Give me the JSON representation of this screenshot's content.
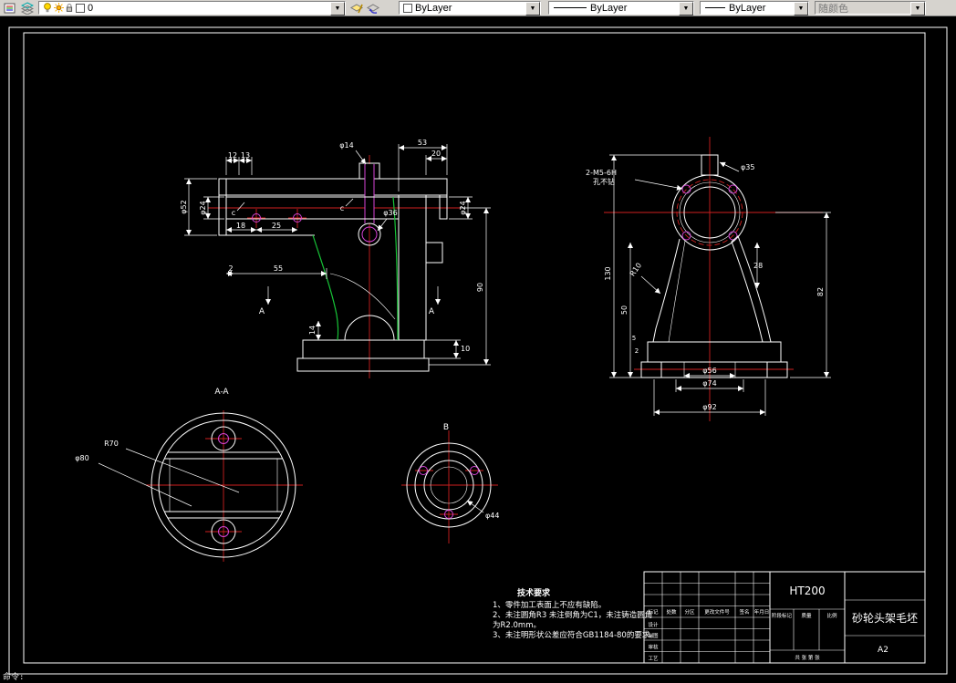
{
  "toolbar": {
    "layer_value": "0",
    "color_value": "ByLayer",
    "linetype_value": "ByLayer",
    "lineweight_value": "ByLayer",
    "plotstyle_value": "随颜色"
  },
  "statusbar": {
    "command": "命令:"
  },
  "colors": {
    "outline": "#ffffff",
    "centerline": "#cf1f1f",
    "contour_green": "#17c437",
    "hole_magenta": "#d643d6",
    "hatch_red": "#cf3060",
    "hatch_purple": "#9a35a8"
  },
  "views": {
    "front": {
      "dims": [
        "12",
        "13",
        "53",
        "20",
        "φ14",
        "φ52",
        "φ24",
        "18",
        "25",
        "2",
        "55",
        "90",
        "10",
        "14",
        "φ36",
        "φ24",
        "c",
        "c",
        "A",
        "A"
      ]
    },
    "side": {
      "dims": [
        "130",
        "50",
        "82",
        "28",
        "φ56",
        "φ74",
        "φ92",
        "R10",
        "φ35",
        "2-M5-6H",
        "孔不钻",
        "5",
        "2"
      ]
    },
    "section_a": {
      "labels": [
        "A-A",
        "R70",
        "φ80"
      ]
    },
    "view_b": {
      "labels": [
        "B",
        "φ44"
      ]
    }
  },
  "tech_req": {
    "title": "技术要求",
    "lines": [
      "1、零件加工表面上不应有缺陷。",
      "2、未注圆角R3 未注倒角为C1，未注铸造圆角",
      "为R2.0mm。",
      "3、未注明形状公差应符合GB1184-80的要求。"
    ]
  },
  "title_block": {
    "material": "HT200",
    "part_name": "砂轮头架毛坯",
    "sheet": "A2",
    "header_cells": [
      "标记",
      "处数",
      "分区",
      "更改文件号",
      "签名",
      "年月日"
    ],
    "row_labels": [
      "设计",
      "制图",
      "审核",
      "工艺"
    ],
    "mid_labels": [
      "阶段标记",
      "质量",
      "比例"
    ],
    "sheet_info": "共 张 第 张"
  }
}
